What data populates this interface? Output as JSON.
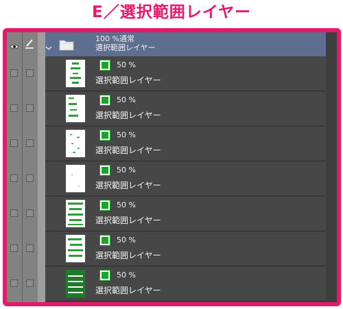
{
  "title": {
    "text": "E／選択範囲レイヤー",
    "color": "#e8196c"
  },
  "header_folder": {
    "line1": "100 %通常",
    "line2": "選択範囲レイヤー"
  },
  "layers": [
    {
      "opacity": "50 %",
      "name": "選択範囲レイヤー"
    },
    {
      "opacity": "50 %",
      "name": "選択範囲レイヤー"
    },
    {
      "opacity": "50 %",
      "name": "選択範囲レイヤー"
    },
    {
      "opacity": "50 %",
      "name": "選択範囲レイヤー"
    },
    {
      "opacity": "50 %",
      "name": "選択範囲レイヤー"
    },
    {
      "opacity": "50 %",
      "name": "選択範囲レイヤー"
    },
    {
      "opacity": "50 %",
      "name": "選択範囲レイヤー"
    }
  ],
  "icons": {
    "visibility": "eye-icon",
    "edit": "pen-icon",
    "expand": "chevron-down-icon",
    "folder": "folder-icon",
    "mask": "selection-mask-icon"
  },
  "colors": {
    "accent": "#e8196c",
    "selected_row": "#5e6e8f",
    "panel_bg": "#474747",
    "mask_green": "#1aa52a"
  }
}
